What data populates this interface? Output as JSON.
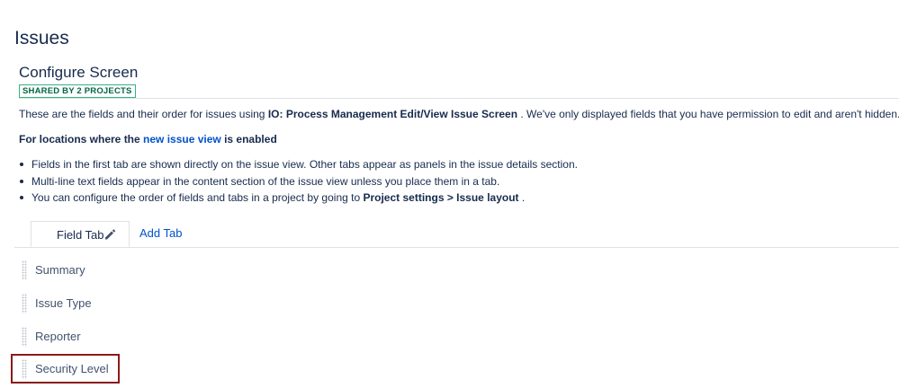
{
  "page": {
    "title": "Issues"
  },
  "header": {
    "subtitle": "Configure Screen",
    "badge": "SHARED BY 2 PROJECTS"
  },
  "description": {
    "prefix": "These are the fields and their order for issues using ",
    "screen_name": "IO: Process Management Edit/View Issue Screen",
    "suffix": " . We've only displayed fields that you have permission to edit and aren't hidden."
  },
  "locations": {
    "prefix": "For locations where the ",
    "link": "new issue view",
    "suffix": " is enabled"
  },
  "bullets": [
    {
      "text": "Fields in the first tab are shown directly on the issue view. Other tabs appear as panels in the issue details section."
    },
    {
      "text": "Multi-line text fields appear in the content section of the issue view unless you place them in a tab."
    },
    {
      "prefix": "You can configure the order of fields and tabs in a project by going to ",
      "bold": "Project settings > Issue layout",
      "suffix": " ."
    }
  ],
  "tabs": {
    "active_label": "Field Tab",
    "edit_icon": "pencil-icon",
    "add_label": "Add Tab"
  },
  "fields": [
    {
      "label": "Summary"
    },
    {
      "label": "Issue Type"
    },
    {
      "label": "Reporter"
    },
    {
      "label": "Security Level"
    }
  ],
  "colors": {
    "text": "#172b4d",
    "link": "#0052cc",
    "badge_border": "#36b37e",
    "badge_text": "#006644",
    "highlight": "#8b1a1a"
  }
}
